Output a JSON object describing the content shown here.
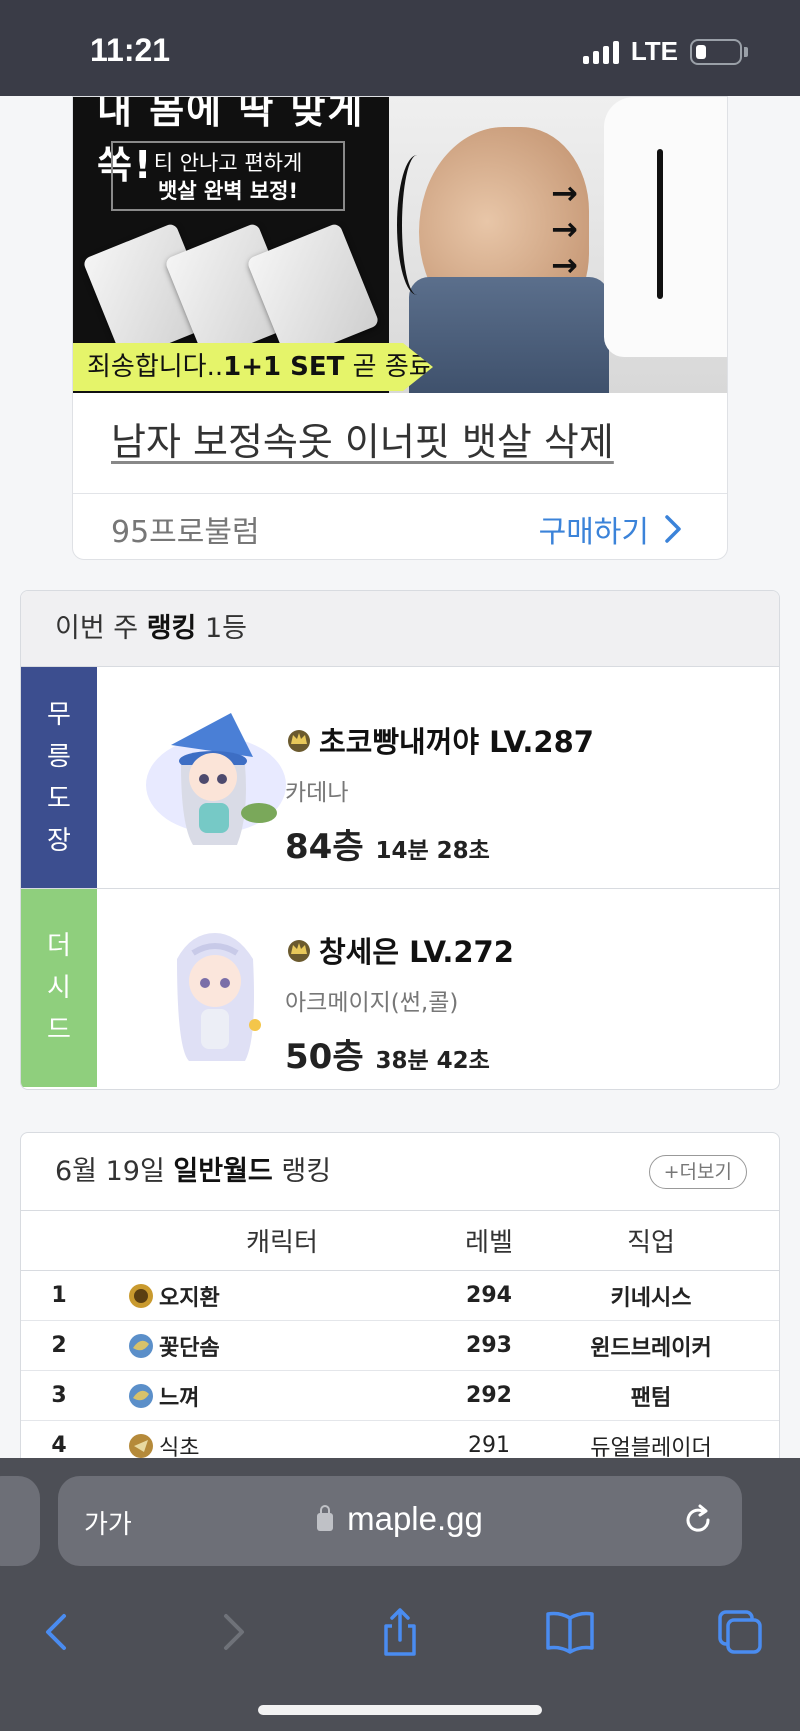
{
  "status_bar": {
    "time": "11:21",
    "network": "LTE"
  },
  "ad": {
    "headline_partial": "내 몸에 딱 맞게 쏙!",
    "box_line1": "티 안나고 편하게",
    "box_line2": "뱃살 완벽 보정!",
    "ribbon_prefix": "죄송합니다..",
    "ribbon_bold": "1+1 SET",
    "ribbon_suffix": " 곧 종료",
    "title": "남자 보정속옷 이너핏 뱃살 삭제",
    "brand": "95프로불럼",
    "buy_label": "구매하기"
  },
  "weekly_ranking": {
    "header_prefix": "이번 주 ",
    "header_bold": "랭킹",
    "header_suffix": " 1등",
    "entries": [
      {
        "tag": [
          "무",
          "릉",
          "도",
          "장"
        ],
        "name": "초코빵내꺼야 LV.287",
        "job": "카데나",
        "floor": "84층",
        "time": "14분 28초",
        "tag_color": "#3c4e8f"
      },
      {
        "tag": [
          "더",
          "시",
          "드"
        ],
        "name": "창세은 LV.272",
        "job": "아크메이지(썬,콜)",
        "floor": "50층",
        "time": "38분 42초",
        "tag_color": "#8fcf7d"
      }
    ]
  },
  "world_ranking": {
    "header_date": "6월 19일 ",
    "header_bold": "일반월드",
    "header_suffix": " 랭킹",
    "more_label": "더보기",
    "columns": [
      "캐릭터",
      "레벨",
      "직업"
    ],
    "rows": [
      {
        "rank": "1",
        "name": "오지환",
        "level": "294",
        "job": "키네시스"
      },
      {
        "rank": "2",
        "name": "꽃단솜",
        "level": "293",
        "job": "윈드브레이커"
      },
      {
        "rank": "3",
        "name": "느껴",
        "level": "292",
        "job": "팬텀"
      },
      {
        "rank": "4",
        "name": "식초",
        "level": "291",
        "job": "듀얼블레이더"
      }
    ]
  },
  "browser": {
    "text_size_label": "가가",
    "url": "maple.gg"
  }
}
